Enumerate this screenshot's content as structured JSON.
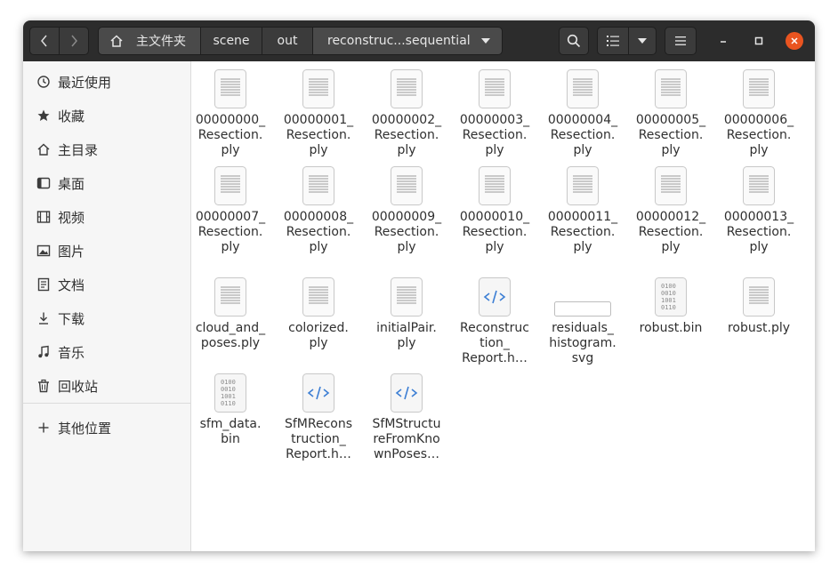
{
  "header": {
    "back_icon": "chevron-left-icon",
    "forward_icon": "chevron-right-icon",
    "breadcrumbs": [
      {
        "label": "主文件夹",
        "icon": "home-icon"
      },
      {
        "label": "scene"
      },
      {
        "label": "out"
      },
      {
        "label": "reconstruc...sequential"
      }
    ],
    "search_icon": "search-icon",
    "view_icon": "list-view-icon",
    "menu_icon": "hamburger-menu-icon",
    "close_color": "#e95420"
  },
  "sidebar": {
    "items": [
      {
        "label": "最近使用",
        "icon": "recent-icon"
      },
      {
        "label": "收藏",
        "icon": "star-icon"
      },
      {
        "label": "主目录",
        "icon": "home-icon"
      },
      {
        "label": "桌面",
        "icon": "desktop-icon"
      },
      {
        "label": "视频",
        "icon": "video-icon"
      },
      {
        "label": "图片",
        "icon": "picture-icon"
      },
      {
        "label": "文档",
        "icon": "document-icon"
      },
      {
        "label": "下载",
        "icon": "download-icon"
      },
      {
        "label": "音乐",
        "icon": "music-icon"
      },
      {
        "label": "回收站",
        "icon": "trash-icon"
      }
    ],
    "other_locations": {
      "label": "其他位置",
      "icon": "plus-icon"
    }
  },
  "files": [
    {
      "name": "00000000_\nResection.\nply",
      "type": "text"
    },
    {
      "name": "00000001_\nResection.\nply",
      "type": "text"
    },
    {
      "name": "00000002_\nResection.\nply",
      "type": "text"
    },
    {
      "name": "00000003_\nResection.\nply",
      "type": "text"
    },
    {
      "name": "00000004_\nResection.\nply",
      "type": "text"
    },
    {
      "name": "00000005_\nResection.\nply",
      "type": "text"
    },
    {
      "name": "00000006_\nResection.\nply",
      "type": "text"
    },
    {
      "name": "00000007_\nResection.\nply",
      "type": "text"
    },
    {
      "name": "00000008_\nResection.\nply",
      "type": "text"
    },
    {
      "name": "00000009_\nResection.\nply",
      "type": "text"
    },
    {
      "name": "00000010_\nResection.\nply",
      "type": "text"
    },
    {
      "name": "00000011_\nResection.\nply",
      "type": "text"
    },
    {
      "name": "00000012_\nResection.\nply",
      "type": "text"
    },
    {
      "name": "00000013_\nResection.\nply",
      "type": "text"
    },
    {
      "name": "cloud_and_\nposes.ply",
      "type": "text"
    },
    {
      "name": "colorized.\nply",
      "type": "text"
    },
    {
      "name": "initialPair.\nply",
      "type": "text"
    },
    {
      "name": "Reconstruc\ntion_\nReport.h…",
      "type": "html"
    },
    {
      "name": "residuals_\nhistogram.\nsvg",
      "type": "svg"
    },
    {
      "name": "robust.bin",
      "type": "binary"
    },
    {
      "name": "robust.ply",
      "type": "text"
    },
    {
      "name": "sfm_data.\nbin",
      "type": "binary"
    },
    {
      "name": "SfMRecons\ntruction_\nReport.h…",
      "type": "html"
    },
    {
      "name": "SfMStructu\nreFromKno\nwnPoses…",
      "type": "html"
    }
  ]
}
